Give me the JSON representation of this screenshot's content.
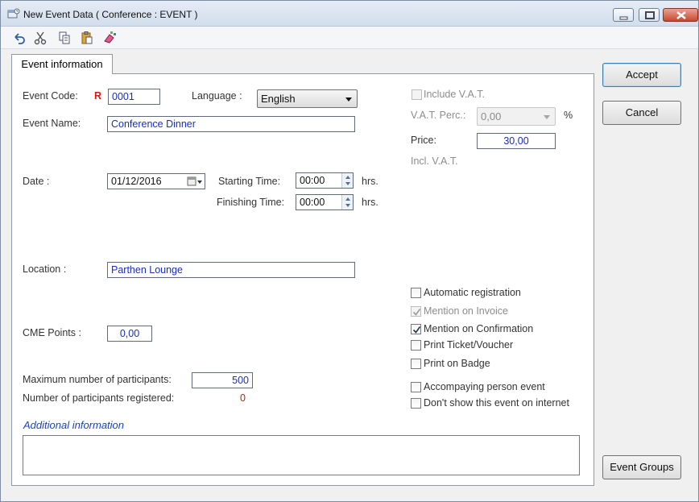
{
  "window": {
    "title": "New Event Data  ( Conference : EVENT )",
    "icons": [
      "app-icon",
      "minimize-icon",
      "maximize-icon",
      "close-icon"
    ]
  },
  "toolbar": {
    "icons": [
      "undo-icon",
      "cut-icon",
      "copy-icon",
      "paste-icon",
      "clear-icon"
    ]
  },
  "tab": {
    "label": "Event information"
  },
  "form": {
    "event_code_label": "Event Code:",
    "required_marker": "R",
    "event_code": "0001",
    "language_label": "Language :",
    "language": "English",
    "event_name_label": "Event Name:",
    "event_name": "Conference Dinner",
    "date_label": "Date :",
    "date": "01/12/2016",
    "starting_time_label": "Starting Time:",
    "starting_time": "00:00",
    "finishing_time_label": "Finishing Time:",
    "finishing_time": "00:00",
    "hrs": "hrs.",
    "location_label": "Location :",
    "location": "Parthen Lounge",
    "cme_points_label": "CME Points :",
    "cme_points": "0,00",
    "max_participants_label": "Maximum number of participants:",
    "max_participants": "500",
    "registered_label": "Number of participants registered:",
    "registered": "0",
    "additional_info_label": "Additional information",
    "additional_info": ""
  },
  "vat": {
    "include_label": "Include V.A.T.",
    "include_checked": false,
    "perc_label": "V.A.T. Perc.:",
    "perc_value": "0,00",
    "perc_unit": "%",
    "price_label": "Price:",
    "price": "30,00",
    "incl_label": "Incl. V.A.T."
  },
  "options": {
    "automatic_registration": {
      "label": "Automatic registration",
      "checked": false
    },
    "mention_invoice": {
      "label": "Mention on Invoice",
      "checked": true,
      "disabled": true
    },
    "mention_confirmation": {
      "label": "Mention on Confirmation",
      "checked": true
    },
    "print_ticket": {
      "label": "Print Ticket/Voucher",
      "checked": false
    },
    "print_badge": {
      "label": "Print on Badge",
      "checked": false
    },
    "accompanying": {
      "label": "Accompaying person event",
      "checked": false
    },
    "dont_show": {
      "label": "Don't show this event on internet",
      "checked": false
    }
  },
  "buttons": {
    "accept": "Accept",
    "cancel": "Cancel",
    "event_groups": "Event Groups"
  },
  "colors": {
    "value_text": "#1a2fb8",
    "required": "#d4180e",
    "section_heading": "#1a3fd1"
  }
}
